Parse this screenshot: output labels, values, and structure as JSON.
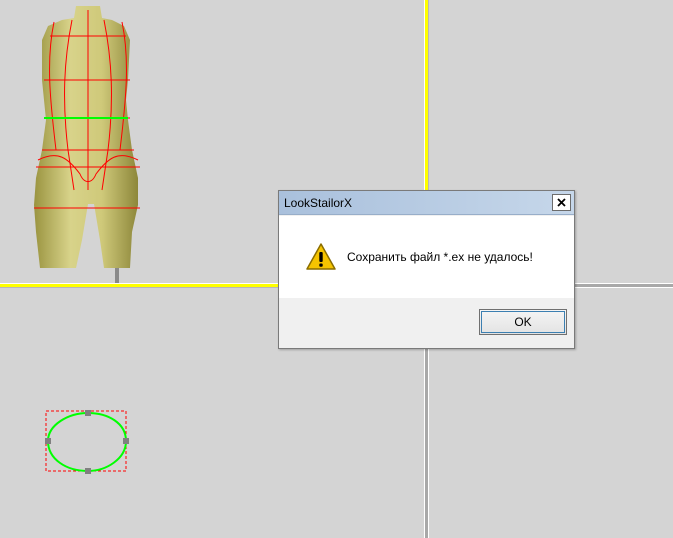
{
  "dialog": {
    "title": "LookStailorX",
    "message": "Сохранить файл *.ex не удалось!",
    "ok_label": "OK",
    "icon": "warning-icon"
  },
  "viewports": {
    "top_left": "mannequin-3d-view",
    "bottom_left": "cross-section-view",
    "divider_color": "#ffff00"
  },
  "colors": {
    "measure_lines": "#ff0000",
    "waist_line": "#00ff00",
    "body": "#c8c26a"
  }
}
